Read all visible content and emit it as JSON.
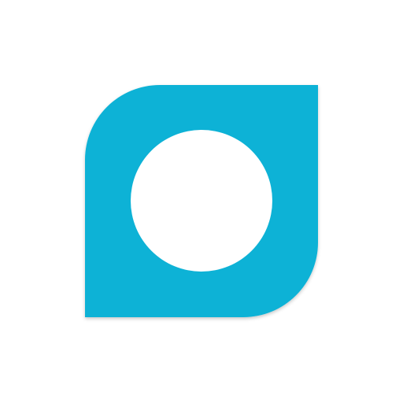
{
  "logo": {
    "icon": "leaf-ring-logo-icon",
    "brand_color": "#0AB2D6",
    "inner_color": "#FFFFFF",
    "background_color": "#FFFFFF"
  }
}
